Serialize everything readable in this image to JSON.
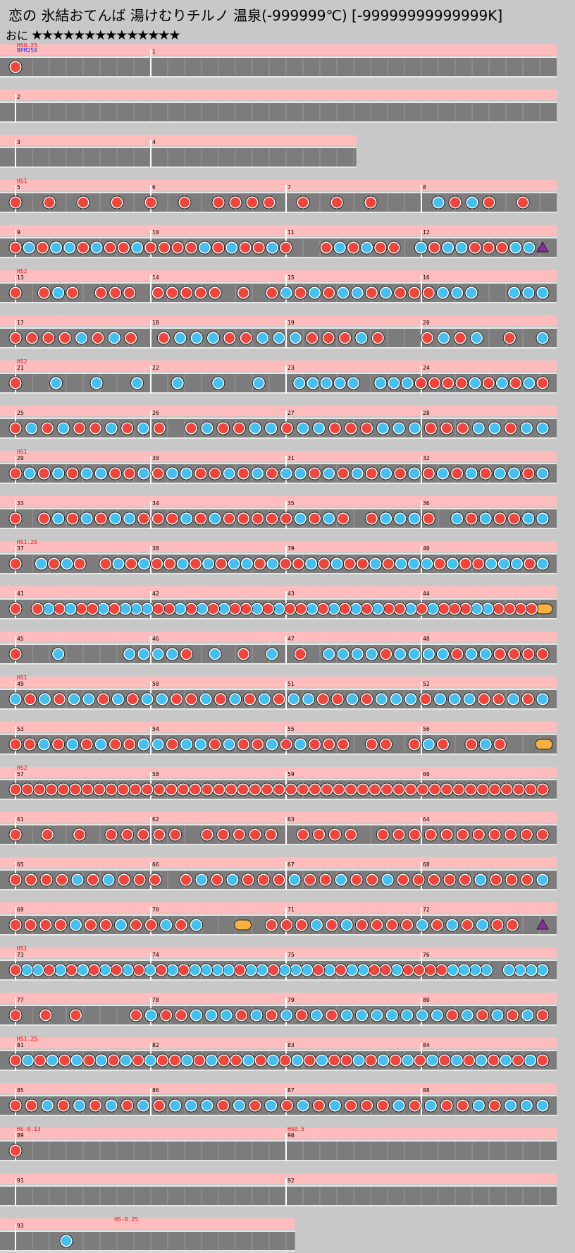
{
  "song": {
    "title": "恋の 氷結おてんば 湯けむりチルノ 温泉(-999999℃) [-99999999999999K]",
    "difficulty": "おに",
    "stars": "★★★★★★★★★★★★★★"
  },
  "colors": {
    "don": "#f0443c",
    "ka": "#44c0f0",
    "roll": "#fff04a",
    "balloon": "#f8b040",
    "lane": "#7c7c7c",
    "lane_edge": "#e6e6e6",
    "scroll_band": "#ffbcbc",
    "marker_text": "#e0141c",
    "bpm_text": "#2238d8"
  },
  "rows": [
    {
      "labels": [
        {
          "m": 1,
          "text": "1"
        }
      ],
      "hs": "HS0.25",
      "bpm": "BPM250",
      "segments": [
        {
          "s": 0,
          "e": 1
        }
      ],
      "notes": "D"
    },
    {
      "labels": [
        {
          "m": 0,
          "text": "2"
        }
      ],
      "segments": [
        {
          "s": 0,
          "e": 1
        }
      ],
      "notes": ""
    },
    {
      "labels": [
        {
          "m": 0,
          "text": "3"
        },
        {
          "m": 1,
          "text": "4"
        }
      ],
      "segments": [
        {
          "s": 0,
          "e": 0.5
        },
        {
          "s": 0.5,
          "e": 0.64
        }
      ],
      "notes": ""
    },
    {
      "labels": [
        {
          "m": 0,
          "text": "5"
        },
        {
          "m": 1,
          "text": "6"
        },
        {
          "m": 2,
          "text": "7"
        },
        {
          "m": 3,
          "text": "8"
        }
      ],
      "hs": "HS1",
      "segments": [
        {
          "s": 0,
          "e": 1
        }
      ],
      "notes": "D.D.D.D.D.D.DDDD.D.D.D...KDKD.D"
    },
    {
      "labels": [
        {
          "m": 0,
          "text": "9"
        },
        {
          "m": 1,
          "text": "10"
        },
        {
          "m": 2,
          "text": "11"
        },
        {
          "m": 3,
          "text": "12"
        }
      ],
      "segments": [
        {
          "s": 0,
          "e": 1
        }
      ],
      "notes": "DKDKKDKDDKDDDDKDKDDKD..DKDKDD.KDKKDDDKKP"
    },
    {
      "labels": [
        {
          "m": 0,
          "text": "13"
        },
        {
          "m": 1,
          "text": "14"
        },
        {
          "m": 2,
          "text": "15"
        },
        {
          "m": 3,
          "text": "16"
        }
      ],
      "hs": "HS2",
      "segments": [
        {
          "s": 0,
          "e": 1
        }
      ],
      "notes": "D.DKD.DDD.DDDDD.D.DKDKDKKDKDDDKKK..KKK"
    },
    {
      "labels": [
        {
          "m": 0,
          "text": "17"
        },
        {
          "m": 1,
          "text": "18"
        },
        {
          "m": 2,
          "text": "19"
        },
        {
          "m": 3,
          "text": "20"
        }
      ],
      "segments": [
        {
          "s": 0,
          "e": 1
        }
      ],
      "notes": "DDDDKDKD.DKKKDDKKKDDDKD..DKDK.D.K"
    },
    {
      "labels": [
        {
          "m": 0,
          "text": "21"
        },
        {
          "m": 1,
          "text": "22"
        },
        {
          "m": 2,
          "text": "23"
        },
        {
          "m": 3,
          "text": "24"
        }
      ],
      "hs": "HS2",
      "segments": [
        {
          "s": 0,
          "e": 1
        }
      ],
      "notes": "D..K..K..K..K..K..K..KKKKK.KKKDDDDKDKDKD"
    },
    {
      "labels": [
        {
          "m": 0,
          "text": "25"
        },
        {
          "m": 1,
          "text": "26"
        },
        {
          "m": 2,
          "text": "27"
        },
        {
          "m": 3,
          "text": "28"
        }
      ],
      "segments": [
        {
          "s": 0,
          "e": 1
        }
      ],
      "notes": "DKDKDDKDKD.DKDDKKDKKDDDKKKDDDKKDKK"
    },
    {
      "labels": [
        {
          "m": 0,
          "text": "29"
        },
        {
          "m": 1,
          "text": "30"
        },
        {
          "m": 2,
          "text": "31"
        },
        {
          "m": 3,
          "text": "32"
        }
      ],
      "hs": "HS1",
      "segments": [
        {
          "s": 0,
          "e": 1
        }
      ],
      "notes": "DKDKDKKDDKDKKDDKDKDKKDKDKDKDKDKDKDKKDK"
    },
    {
      "labels": [
        {
          "m": 0,
          "text": "33"
        },
        {
          "m": 1,
          "text": "34"
        },
        {
          "m": 2,
          "text": "35"
        },
        {
          "m": 3,
          "text": "36"
        }
      ],
      "segments": [
        {
          "s": 0,
          "e": 1
        }
      ],
      "notes": "D.DKDKDKKDDDKDKDDDDDKDKD.DKKKD.KDKDDKK"
    },
    {
      "labels": [
        {
          "m": 0,
          "text": "37"
        },
        {
          "m": 1,
          "text": "38"
        },
        {
          "m": 2,
          "text": "39"
        },
        {
          "m": 3,
          "text": "40"
        }
      ],
      "hs": "HS1.25",
      "segments": [
        {
          "s": 0,
          "e": 1
        }
      ],
      "notes": "D.KDKD.DKDKDDKDKDKKDKDDKDKDDKDKKKDKDDKKKDK"
    },
    {
      "labels": [
        {
          "m": 0,
          "text": "41"
        },
        {
          "m": 1,
          "text": "42"
        },
        {
          "m": 2,
          "text": "43"
        },
        {
          "m": 3,
          "text": "44"
        }
      ],
      "segments": [
        {
          "s": 0,
          "e": 1
        }
      ],
      "notes": "D.DKDKDDKDKKKDDKDKDKDDKDKDDKDKDKDKDDKDKDDDKKDDDDB"
    },
    {
      "labels": [
        {
          "m": 0,
          "text": "45"
        },
        {
          "m": 1,
          "text": "46"
        },
        {
          "m": 2,
          "text": "47"
        },
        {
          "m": 3,
          "text": "48"
        }
      ],
      "segments": [
        {
          "s": 0,
          "e": 1
        }
      ],
      "notes": "D..K....KKKKD.K.D.K.D.KKKKDKKKKDKKDDDD"
    },
    {
      "labels": [
        {
          "m": 0,
          "text": "49"
        },
        {
          "m": 1,
          "text": "50"
        },
        {
          "m": 2,
          "text": "51"
        },
        {
          "m": 3,
          "text": "52"
        }
      ],
      "hs": "HS1",
      "segments": [
        {
          "s": 0,
          "e": 1
        }
      ],
      "notes": "KDKDKKDKDKKDDKDKDKDKKDDKDKKKDKKKDDKDK"
    },
    {
      "labels": [
        {
          "m": 0,
          "text": "53"
        },
        {
          "m": 1,
          "text": "54"
        },
        {
          "m": 2,
          "text": "55"
        },
        {
          "m": 3,
          "text": "56"
        }
      ],
      "segments": [
        {
          "s": 0,
          "e": 1
        }
      ],
      "notes": "DDKDKDKDDKKDKKDKDDKDKDDD.DD.DKD.DKD..B"
    },
    {
      "labels": [
        {
          "m": 0,
          "text": "57"
        },
        {
          "m": 1,
          "text": "58"
        },
        {
          "m": 2,
          "text": "59"
        },
        {
          "m": 3,
          "text": "60"
        }
      ],
      "hs": "HS2",
      "segments": [
        {
          "s": 0,
          "e": 1
        }
      ],
      "notes": "DDDDDDDDDDDDDDDDDDDDDDDDDDDDDDDDDDDDDDDDDDDDD"
    },
    {
      "labels": [
        {
          "m": 0,
          "text": "61"
        },
        {
          "m": 1,
          "text": "62"
        },
        {
          "m": 2,
          "text": "63"
        },
        {
          "m": 3,
          "text": "64"
        }
      ],
      "segments": [
        {
          "s": 0,
          "e": 1
        }
      ],
      "notes": "D.D.D.DDDDD.DDDDD.DDDD.DDDDDDDDDDD"
    },
    {
      "labels": [
        {
          "m": 0,
          "text": "65"
        },
        {
          "m": 1,
          "text": "66"
        },
        {
          "m": 2,
          "text": "67"
        },
        {
          "m": 3,
          "text": "68"
        }
      ],
      "segments": [
        {
          "s": 0,
          "e": 1
        }
      ],
      "notes": "DDDDKDKDDD.DKDKDDDKDDKDDKDDDDDKDDDK"
    },
    {
      "labels": [
        {
          "m": 0,
          "text": "69"
        },
        {
          "m": 1,
          "text": "70"
        },
        {
          "m": 2,
          "text": "71"
        },
        {
          "m": 3,
          "text": "72"
        }
      ],
      "segments": [
        {
          "s": 0,
          "e": 1
        }
      ],
      "notes": "DDDDKDDKDDKDK..B.DDDKDKDDDDKDKDKDD.P"
    },
    {
      "labels": [
        {
          "m": 0,
          "text": "73"
        },
        {
          "m": 1,
          "text": "74"
        },
        {
          "m": 2,
          "text": "75"
        },
        {
          "m": 3,
          "text": "76"
        }
      ],
      "hs": "HS1",
      "segments": [
        {
          "s": 0,
          "e": 1
        }
      ],
      "notes": "DKKDKDKDKDKDKDKDKKKKDKKDKKKDKDKKDDKDDDDKKKK.KKKK"
    },
    {
      "labels": [
        {
          "m": 0,
          "text": "77"
        },
        {
          "m": 1,
          "text": "78"
        },
        {
          "m": 2,
          "text": "79"
        },
        {
          "m": 3,
          "text": "80"
        }
      ],
      "segments": [
        {
          "s": 0,
          "e": 1
        }
      ],
      "notes": "D.D.D...DKDDKKKDKDKDKDKKKKKKKDKDKDKD"
    },
    {
      "labels": [
        {
          "m": 0,
          "text": "81"
        },
        {
          "m": 1,
          "text": "82"
        },
        {
          "m": 2,
          "text": "83"
        },
        {
          "m": 3,
          "text": "84"
        }
      ],
      "hs": "HS1.25",
      "segments": [
        {
          "s": 0,
          "e": 1
        }
      ],
      "notes": "DKDKDKDKDKDKDDKDKDDKDKDKDKDDKDKDKDKDKDKDKDKD"
    },
    {
      "labels": [
        {
          "m": 0,
          "text": "85"
        },
        {
          "m": 1,
          "text": "86"
        },
        {
          "m": 2,
          "text": "87"
        },
        {
          "m": 3,
          "text": "88"
        }
      ],
      "segments": [
        {
          "s": 0,
          "e": 1
        }
      ],
      "notes": "DDKDKDKDKDKKKDKDKDKDKDDDKDKDDKDKKK"
    },
    {
      "labels": [
        {
          "m": 0,
          "text": "89"
        },
        {
          "m": 2,
          "text": "90"
        }
      ],
      "hs": "HS-0.13",
      "hs2": "HS0.5",
      "segments": [
        {
          "s": 0,
          "e": 1
        }
      ],
      "notes": "D"
    },
    {
      "labels": [
        {
          "m": 0,
          "text": "91"
        },
        {
          "m": 2,
          "text": "92"
        }
      ],
      "segments": [
        {
          "s": 0,
          "e": 1
        }
      ],
      "notes": ""
    },
    {
      "labels": [
        {
          "m": 0,
          "text": "93"
        }
      ],
      "hs3": "HS-0.25",
      "segments": [
        {
          "s": 0,
          "e": 0.53
        }
      ],
      "notes": "...K"
    }
  ]
}
